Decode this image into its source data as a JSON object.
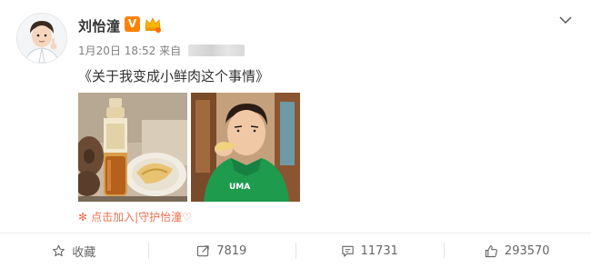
{
  "post": {
    "author": "刘怡潼",
    "verified_mark": "V",
    "timestamp": "1月20日 18:52",
    "source_prefix": "来自",
    "text": "《关于我变成小鲜肉这个事情》",
    "fan_link": "点击加入|守护怡潼♡"
  },
  "actions": {
    "favorite_label": "收藏",
    "repost_count": "7819",
    "comment_count": "11731",
    "like_count": "293570"
  },
  "colors": {
    "verified": "#ff8200",
    "fan_link": "#eb7350",
    "text": "#333333",
    "meta": "#808080"
  },
  "icons": {
    "menu": "chevron-down-icon",
    "favorite": "star-icon",
    "repost": "repost-icon",
    "comment": "comment-icon",
    "like": "thumbs-up-icon"
  }
}
